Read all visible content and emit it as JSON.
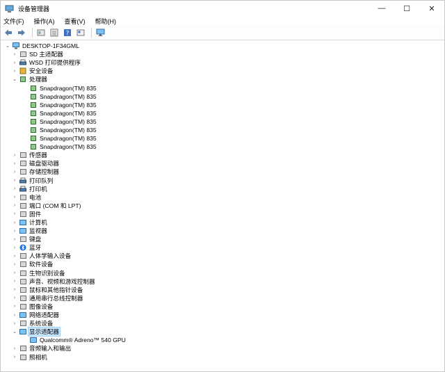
{
  "window": {
    "title": "设备管理器",
    "controls": {
      "minimize": "—",
      "maximize": "☐",
      "close": "✕"
    }
  },
  "menubar": [
    "文件(F)",
    "操作(A)",
    "查看(V)",
    "帮助(H)"
  ],
  "toolbar": [
    "back-icon",
    "forward-icon",
    "properties-icon",
    "view-icon",
    "help-icon",
    "details-icon",
    "monitor-icon"
  ],
  "tree": {
    "root": "DESKTOP-1F34GML",
    "items": [
      {
        "label": "SD 主适配器",
        "expanded": false,
        "icon": "sd-icon"
      },
      {
        "label": "WSD 打印提供程序",
        "expanded": false,
        "icon": "printer-icon"
      },
      {
        "label": "安全设备",
        "expanded": false,
        "icon": "security-icon"
      },
      {
        "label": "处理器",
        "expanded": true,
        "icon": "cpu-icon",
        "children": [
          "Snapdragon(TM) 835",
          "Snapdragon(TM) 835",
          "Snapdragon(TM) 835",
          "Snapdragon(TM) 835",
          "Snapdragon(TM) 835",
          "Snapdragon(TM) 835",
          "Snapdragon(TM) 835",
          "Snapdragon(TM) 835"
        ]
      },
      {
        "label": "传感器",
        "expanded": false,
        "icon": "sensor-icon"
      },
      {
        "label": "磁盘驱动器",
        "expanded": false,
        "icon": "disk-icon"
      },
      {
        "label": "存储控制器",
        "expanded": false,
        "icon": "storage-icon"
      },
      {
        "label": "打印队列",
        "expanded": false,
        "icon": "printer-icon"
      },
      {
        "label": "打印机",
        "expanded": false,
        "icon": "printer-icon"
      },
      {
        "label": "电池",
        "expanded": false,
        "icon": "battery-icon"
      },
      {
        "label": "端口 (COM 和 LPT)",
        "expanded": false,
        "icon": "port-icon"
      },
      {
        "label": "固件",
        "expanded": false,
        "icon": "firmware-icon"
      },
      {
        "label": "计算机",
        "expanded": false,
        "icon": "computer-icon"
      },
      {
        "label": "监视器",
        "expanded": false,
        "icon": "monitor-icon"
      },
      {
        "label": "键盘",
        "expanded": false,
        "icon": "keyboard-icon"
      },
      {
        "label": "蓝牙",
        "expanded": false,
        "icon": "bluetooth-icon"
      },
      {
        "label": "人体学输入设备",
        "expanded": false,
        "icon": "hid-icon"
      },
      {
        "label": "软件设备",
        "expanded": false,
        "icon": "software-icon"
      },
      {
        "label": "生物识别设备",
        "expanded": false,
        "icon": "biometric-icon"
      },
      {
        "label": "声音、视频和游戏控制器",
        "expanded": false,
        "icon": "sound-icon"
      },
      {
        "label": "鼠标和其他指针设备",
        "expanded": false,
        "icon": "mouse-icon"
      },
      {
        "label": "通用串行总线控制器",
        "expanded": false,
        "icon": "usb-icon"
      },
      {
        "label": "图像设备",
        "expanded": false,
        "icon": "camera-icon"
      },
      {
        "label": "网络适配器",
        "expanded": false,
        "icon": "network-icon"
      },
      {
        "label": "系统设备",
        "expanded": false,
        "icon": "system-icon"
      },
      {
        "label": "显示适配器",
        "expanded": true,
        "selected": true,
        "icon": "display-adapter-icon",
        "children": [
          "Qualcomm® Adreno™ 540 GPU"
        ]
      },
      {
        "label": "音频输入和输出",
        "expanded": false,
        "icon": "audio-icon"
      },
      {
        "label": "照相机",
        "expanded": false,
        "icon": "camera-icon"
      }
    ]
  }
}
